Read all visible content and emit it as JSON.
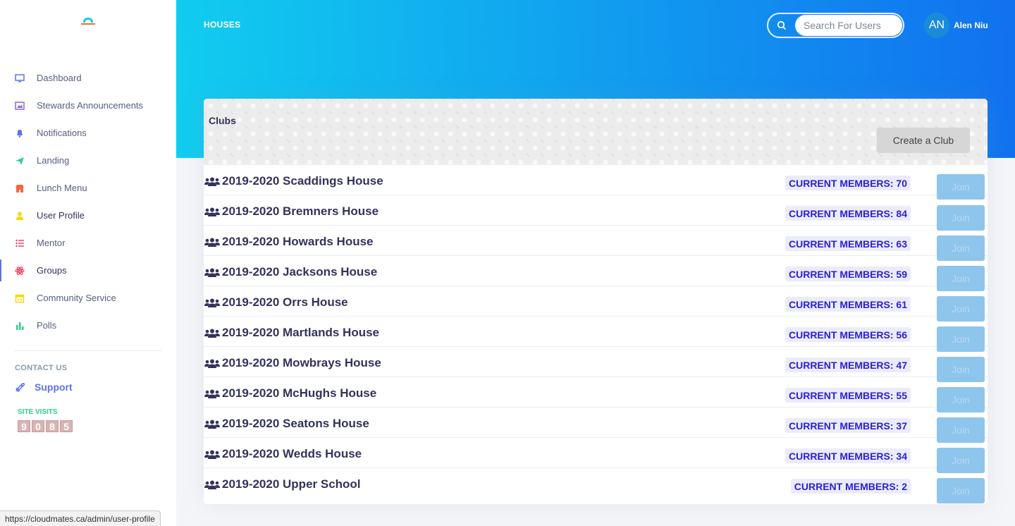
{
  "sidebar": {
    "items": [
      {
        "label": "Dashboard",
        "icon": "monitor-icon",
        "color": "#5e72e4"
      },
      {
        "label": "Stewards Announcements",
        "icon": "image-icon",
        "color": "#8965e0"
      },
      {
        "label": "Notifications",
        "icon": "bell-icon",
        "color": "#5e72e4"
      },
      {
        "label": "Landing",
        "icon": "send-icon",
        "color": "#2dce89"
      },
      {
        "label": "Lunch Menu",
        "icon": "shop-icon",
        "color": "#fb6340"
      },
      {
        "label": "User Profile",
        "icon": "user-icon",
        "color": "#ffd600"
      },
      {
        "label": "Mentor",
        "icon": "list-icon",
        "color": "#f3a4b5"
      },
      {
        "label": "Groups",
        "icon": "atom-icon",
        "color": "#f5365c"
      },
      {
        "label": "Community Service",
        "icon": "calendar-icon",
        "color": "#ffd600"
      },
      {
        "label": "Polls",
        "icon": "chart-bar-icon",
        "color": "#2dce89"
      }
    ],
    "active": "Groups",
    "contact_heading": "CONTACT US",
    "support_label": "Support",
    "site_visits_label": "SITE VISITS",
    "site_visits_digits": [
      "9",
      "0",
      "8",
      "5"
    ]
  },
  "header": {
    "title": "HOUSES",
    "search_placeholder": "Search For Users",
    "avatar_initials": "AN",
    "user_name": "Alen Niu"
  },
  "card": {
    "title": "Clubs",
    "create_button": "Create a Club",
    "clubs": [
      {
        "name": "2019-2020 Scaddings House",
        "members": "CURRENT MEMBERS: 70",
        "join": "Join"
      },
      {
        "name": "2019-2020 Bremners House",
        "members": "CURRENT MEMBERS: 84",
        "join": "Join"
      },
      {
        "name": "2019-2020 Howards House",
        "members": "CURRENT MEMBERS: 63",
        "join": "Join"
      },
      {
        "name": "2019-2020 Jacksons House",
        "members": "CURRENT MEMBERS: 59",
        "join": "Join"
      },
      {
        "name": "2019-2020 Orrs House",
        "members": "CURRENT MEMBERS: 61",
        "join": "Join"
      },
      {
        "name": "2019-2020 Martlands House",
        "members": "CURRENT MEMBERS: 56",
        "join": "Join"
      },
      {
        "name": "2019-2020 Mowbrays House",
        "members": "CURRENT MEMBERS: 47",
        "join": "Join"
      },
      {
        "name": "2019-2020 McHughs House",
        "members": "CURRENT MEMBERS: 55",
        "join": "Join"
      },
      {
        "name": "2019-2020 Seatons House",
        "members": "CURRENT MEMBERS: 37",
        "join": "Join"
      },
      {
        "name": "2019-2020 Wedds House",
        "members": "CURRENT MEMBERS: 34",
        "join": "Join"
      },
      {
        "name": "2019-2020 Upper School",
        "members": "CURRENT MEMBERS: 2",
        "join": "Join"
      }
    ]
  },
  "status_bar": {
    "url": "https://cloudmates.ca/admin/user-profile"
  },
  "colors": {
    "gradient_start": "#11cdef",
    "gradient_end": "#1171ef",
    "badge_text": "#2b1ed8",
    "join_bg": "#8ec5ed"
  }
}
